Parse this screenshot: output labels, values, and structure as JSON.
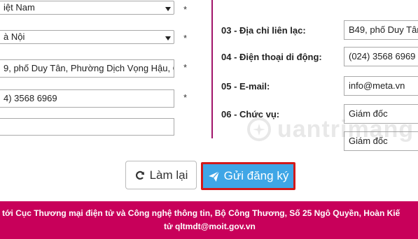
{
  "left_form": {
    "country_value": "iệt Nam",
    "city_value": "à Nội",
    "address_value": "9, phố Duy Tân, Phường Dịch Vọng Hậu, Qu",
    "phone_value": "4) 3568 6969",
    "extra_value": "",
    "required_mark": "*"
  },
  "right_form": {
    "fields": [
      {
        "label": "03 - Địa chỉ liên lạc:",
        "value": "B49, phố Duy Tân"
      },
      {
        "label": "04 - Điện thoại di động:",
        "value": "(024) 3568 6969"
      },
      {
        "label": "05 - E-mail:",
        "value": "info@meta.vn"
      },
      {
        "label": "06 - Chức vụ:",
        "value": "Giám đốc"
      },
      {
        "label": "",
        "value": "Giám đốc"
      }
    ]
  },
  "buttons": {
    "reset_label": "Làm lại",
    "submit_label": "Gửi đăng ký"
  },
  "footer": {
    "line1": "tới Cục Thương mại điện tử và Công nghệ thông tin, Bộ Công Thương, Số 25 Ngô Quyền, Hoàn Kiế",
    "line2": "tử qltmdt@moit.gov.vn"
  },
  "watermark": {
    "text": "uantrimang",
    "icon": "quantrimang-logo-icon"
  },
  "colors": {
    "accent": "#c8005a",
    "divider": "#a1146a",
    "submit_bg": "#3fa6e6",
    "submit_border": "#d21a1a"
  }
}
